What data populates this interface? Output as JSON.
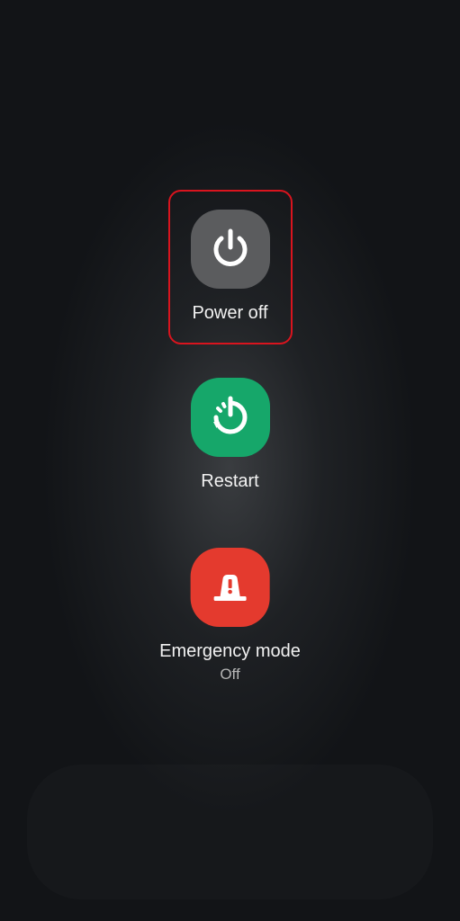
{
  "menu": {
    "power_off": {
      "label": "Power off",
      "icon": "power-icon",
      "color": "#5b5c5e",
      "selected": true
    },
    "restart": {
      "label": "Restart",
      "icon": "restart-icon",
      "color": "#16a76a"
    },
    "emergency": {
      "label": "Emergency mode",
      "status": "Off",
      "icon": "emergency-siren-icon",
      "color": "#e43a2e"
    }
  },
  "colors": {
    "background": "#121417",
    "highlight_border": "#d9141e"
  }
}
